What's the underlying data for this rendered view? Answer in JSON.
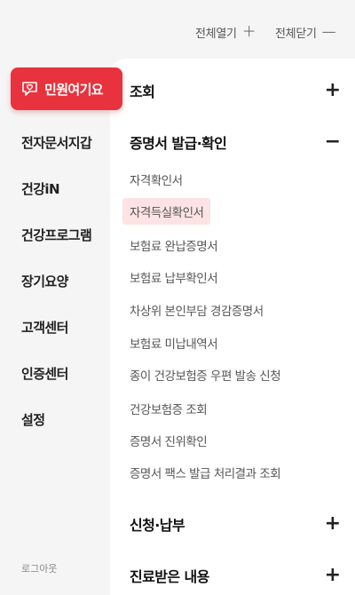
{
  "topbar": {
    "expand_all": "전체열기",
    "collapse_all": "전체닫기",
    "expand_icon": "plus-icon",
    "collapse_icon": "minus-icon"
  },
  "sidebar": {
    "active": {
      "label": "민원여기요",
      "icon": "heart-chat-icon"
    },
    "items": [
      "전자문서지갑",
      "건강iN",
      "건강프로그램",
      "장기요양",
      "고객센터",
      "인증센터",
      "설정"
    ],
    "logout": "로그아웃"
  },
  "sections": [
    {
      "title": "조회",
      "toggle": "+"
    },
    {
      "title": "증명서 발급·확인",
      "toggle": "−"
    },
    {
      "title": "신청·납부",
      "toggle": "+"
    },
    {
      "title": "진료받은 내용",
      "toggle": "+"
    }
  ],
  "sub_items": [
    "자격확인서",
    "자격득실확인서",
    "보험료 완납증명서",
    "보험료 납부확인서",
    "차상위 본인부담 경감증명서",
    "보험료 미납내역서",
    "종이 건강보험증 우편 발송 신청",
    "건강보험증 조회",
    "증명서 진위확인",
    "증명서 팩스 발급 처리결과 조회"
  ],
  "highlight_color": "#fde3e4",
  "accent_color": "#e8323d"
}
